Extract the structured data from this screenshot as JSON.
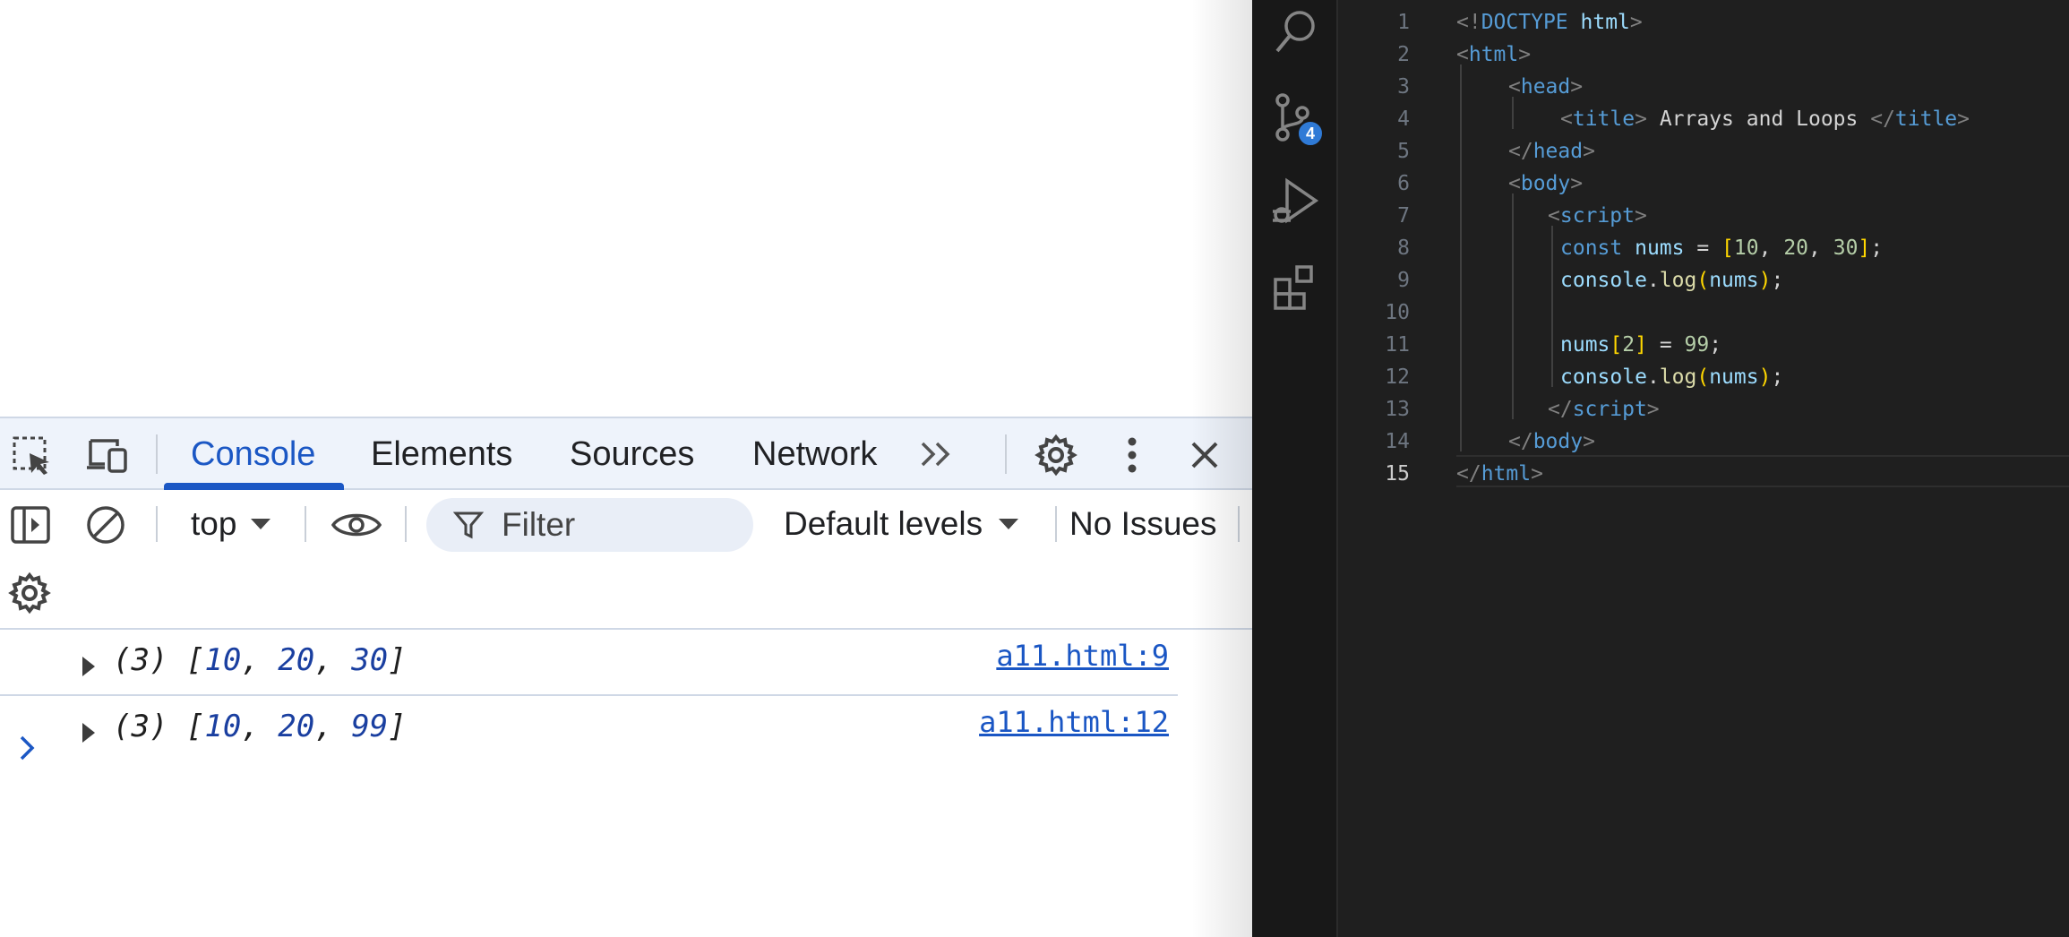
{
  "devtools": {
    "tabs": {
      "console": "Console",
      "elements": "Elements",
      "sources": "Sources",
      "network": "Network"
    },
    "toolbar": {
      "context": "top",
      "filter_placeholder": "Filter",
      "levels": "Default levels",
      "issues": "No Issues"
    },
    "log": [
      {
        "count": "(3)",
        "values": [
          "10",
          "20",
          "30"
        ],
        "source": "a11.html:9"
      },
      {
        "count": "(3)",
        "values": [
          "10",
          "20",
          "99"
        ],
        "source": "a11.html:12"
      }
    ]
  },
  "vscode": {
    "scm_badge": "4",
    "active_line": 15,
    "lines": [
      {
        "n": "1"
      },
      {
        "n": "2"
      },
      {
        "n": "3"
      },
      {
        "n": "4"
      },
      {
        "n": "5"
      },
      {
        "n": "6"
      },
      {
        "n": "7"
      },
      {
        "n": "8"
      },
      {
        "n": "9"
      },
      {
        "n": "10"
      },
      {
        "n": "11"
      },
      {
        "n": "12"
      },
      {
        "n": "13"
      },
      {
        "n": "14"
      },
      {
        "n": "15"
      }
    ],
    "code": {
      "doctype": "DOCTYPE",
      "html_kw": "html",
      "head": "head",
      "title": "title",
      "title_text": " Arrays and Loops ",
      "body": "body",
      "script": "script",
      "const": "const",
      "nums": "nums",
      "console": "console",
      "log": "log",
      "v10": "10",
      "v20": "20",
      "v30": "30",
      "v2": "2",
      "v99": "99"
    }
  }
}
